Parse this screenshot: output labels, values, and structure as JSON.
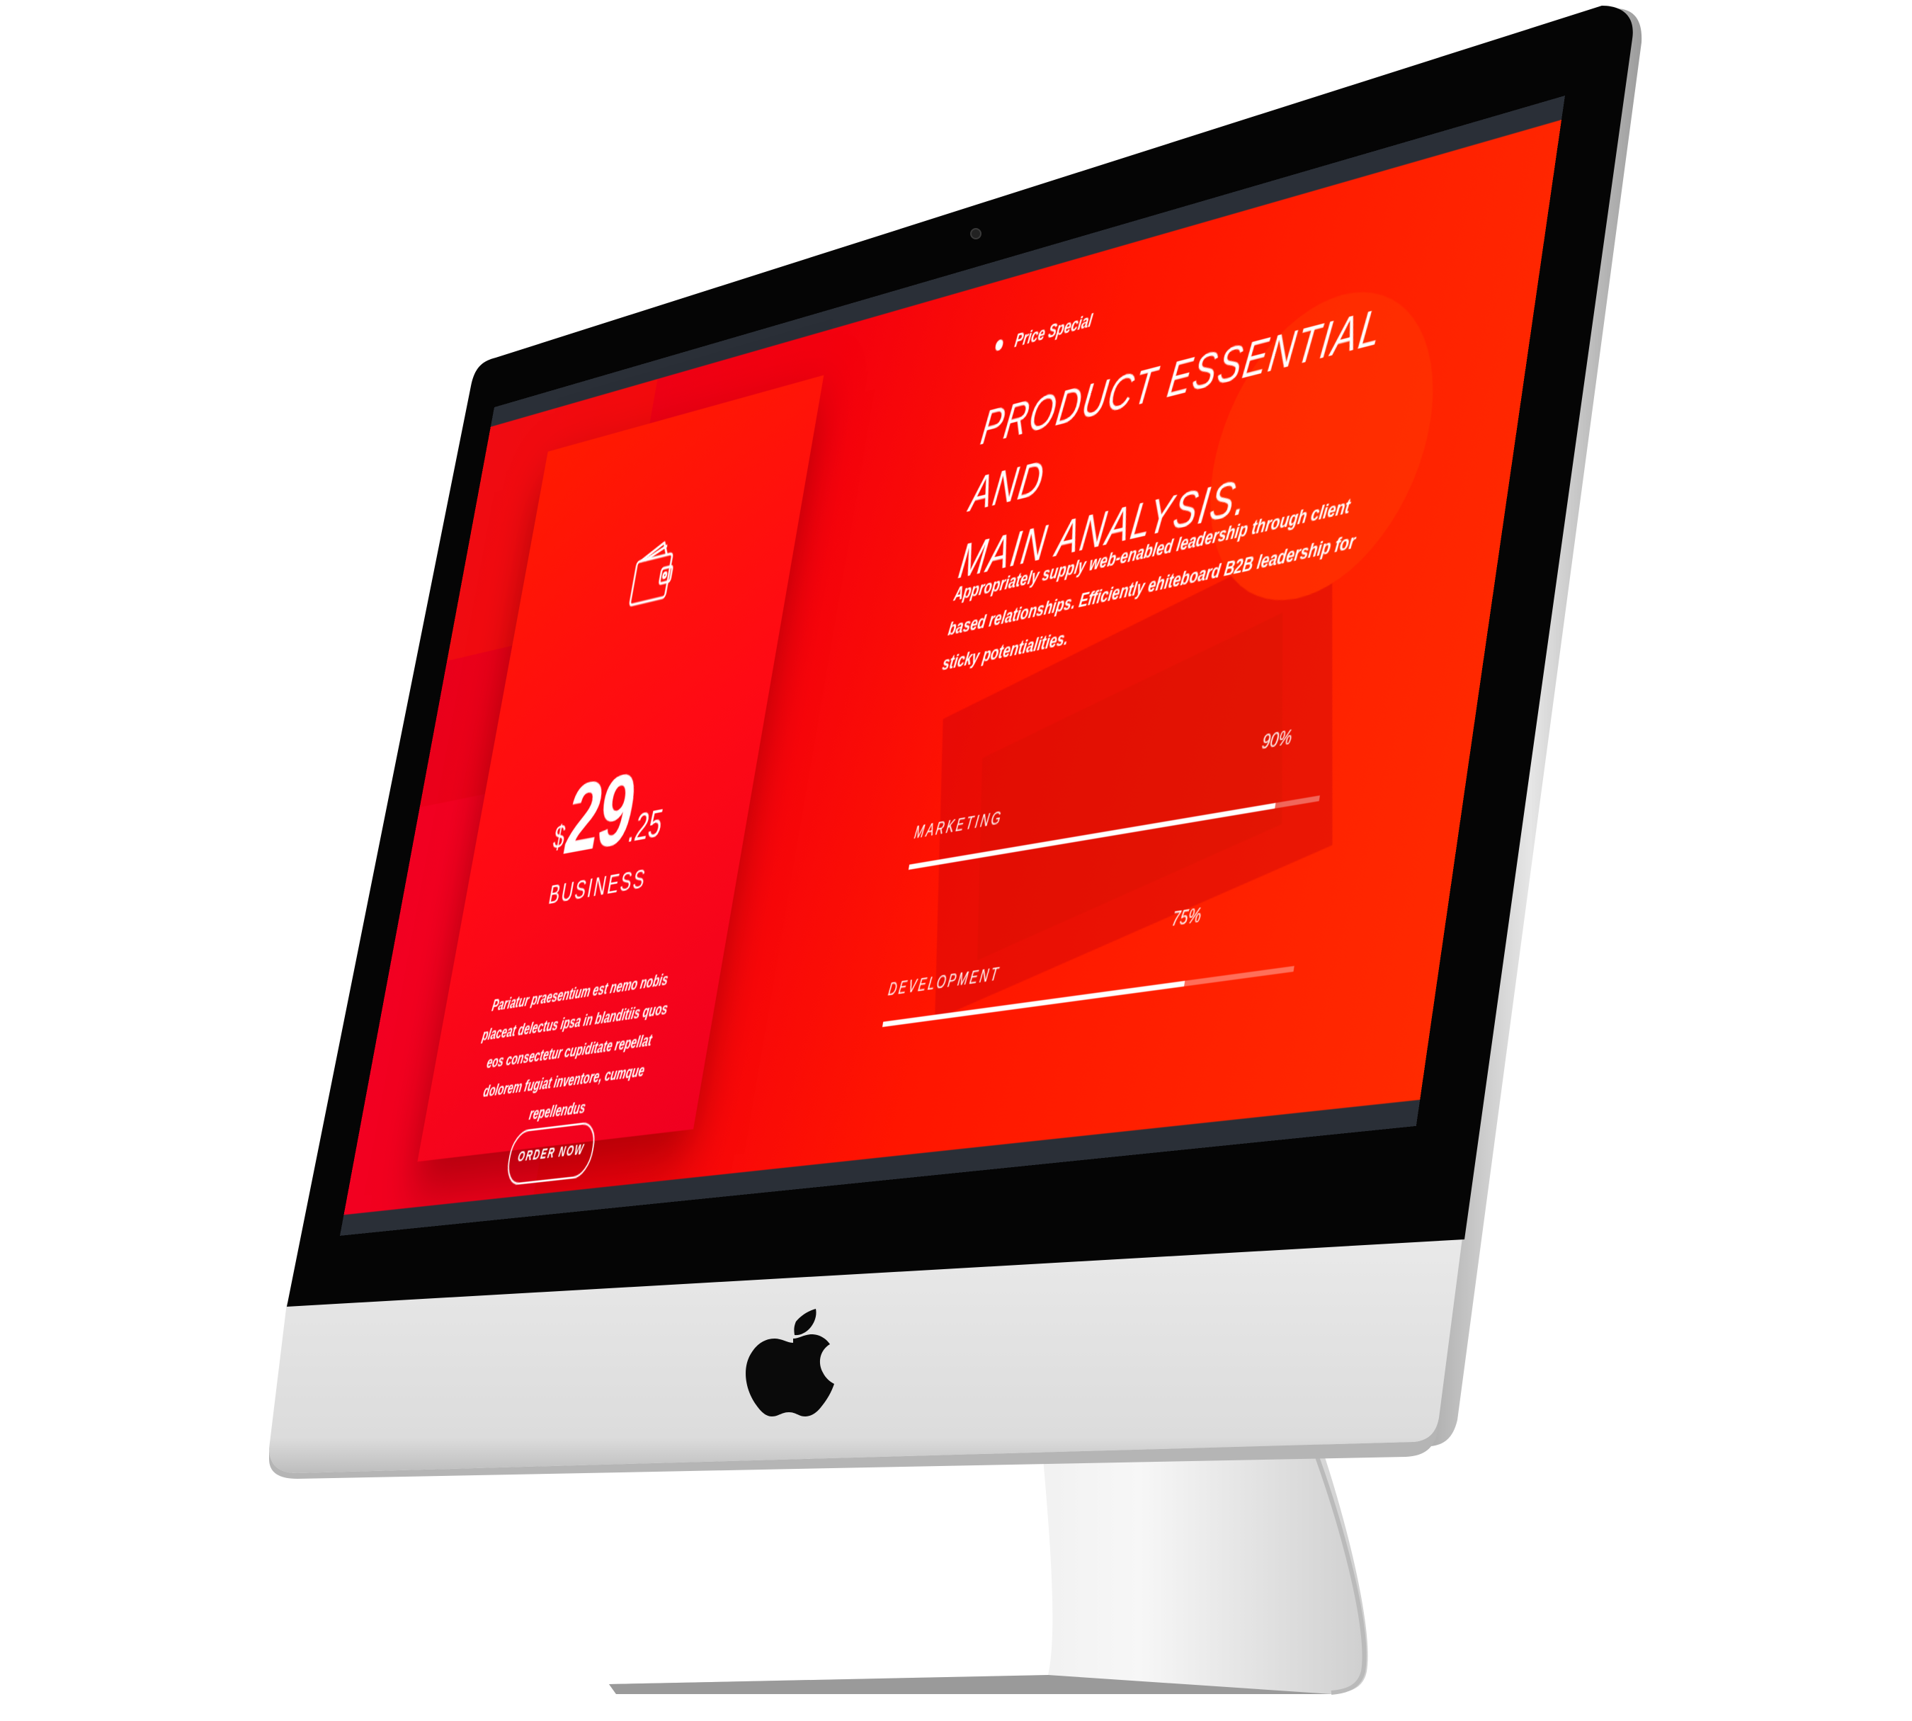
{
  "device": {
    "brand_logo": "apple-logo"
  },
  "pricing_card": {
    "icon": "wallet-icon",
    "currency": "$",
    "price_main": "29",
    "price_cents": ".25",
    "plan_name": "BUSINESS",
    "description": "Pariatur praesentium est nemo nobis placeat delectus ipsa in blanditiis quos eos consectetur cupiditate repellat dolorem fugiat inventore, cumque repellendus",
    "button_label": "ORDER NOW"
  },
  "feature": {
    "eyebrow": "Price Special",
    "headline_line1": "PRODUCT ESSENTIAL AND",
    "headline_line2": "MAIN ANALYSIS.",
    "body": "Appropriately supply web-enabled leadership through client based relationships. Efficiently ehiteboard B2B leadership for sticky potentialities.",
    "skills": [
      {
        "label": "MARKETING",
        "value_text": "90%",
        "value": 0.9
      },
      {
        "label": "DEVELOPMENT",
        "value_text": "75%",
        "value": 0.75
      }
    ]
  },
  "colors": {
    "accent_red": "#ff1a00",
    "deep_red": "#e8001c",
    "screen_strip": "#2a2f37",
    "bezel": "#000000",
    "chin": "#e4e4e4"
  }
}
